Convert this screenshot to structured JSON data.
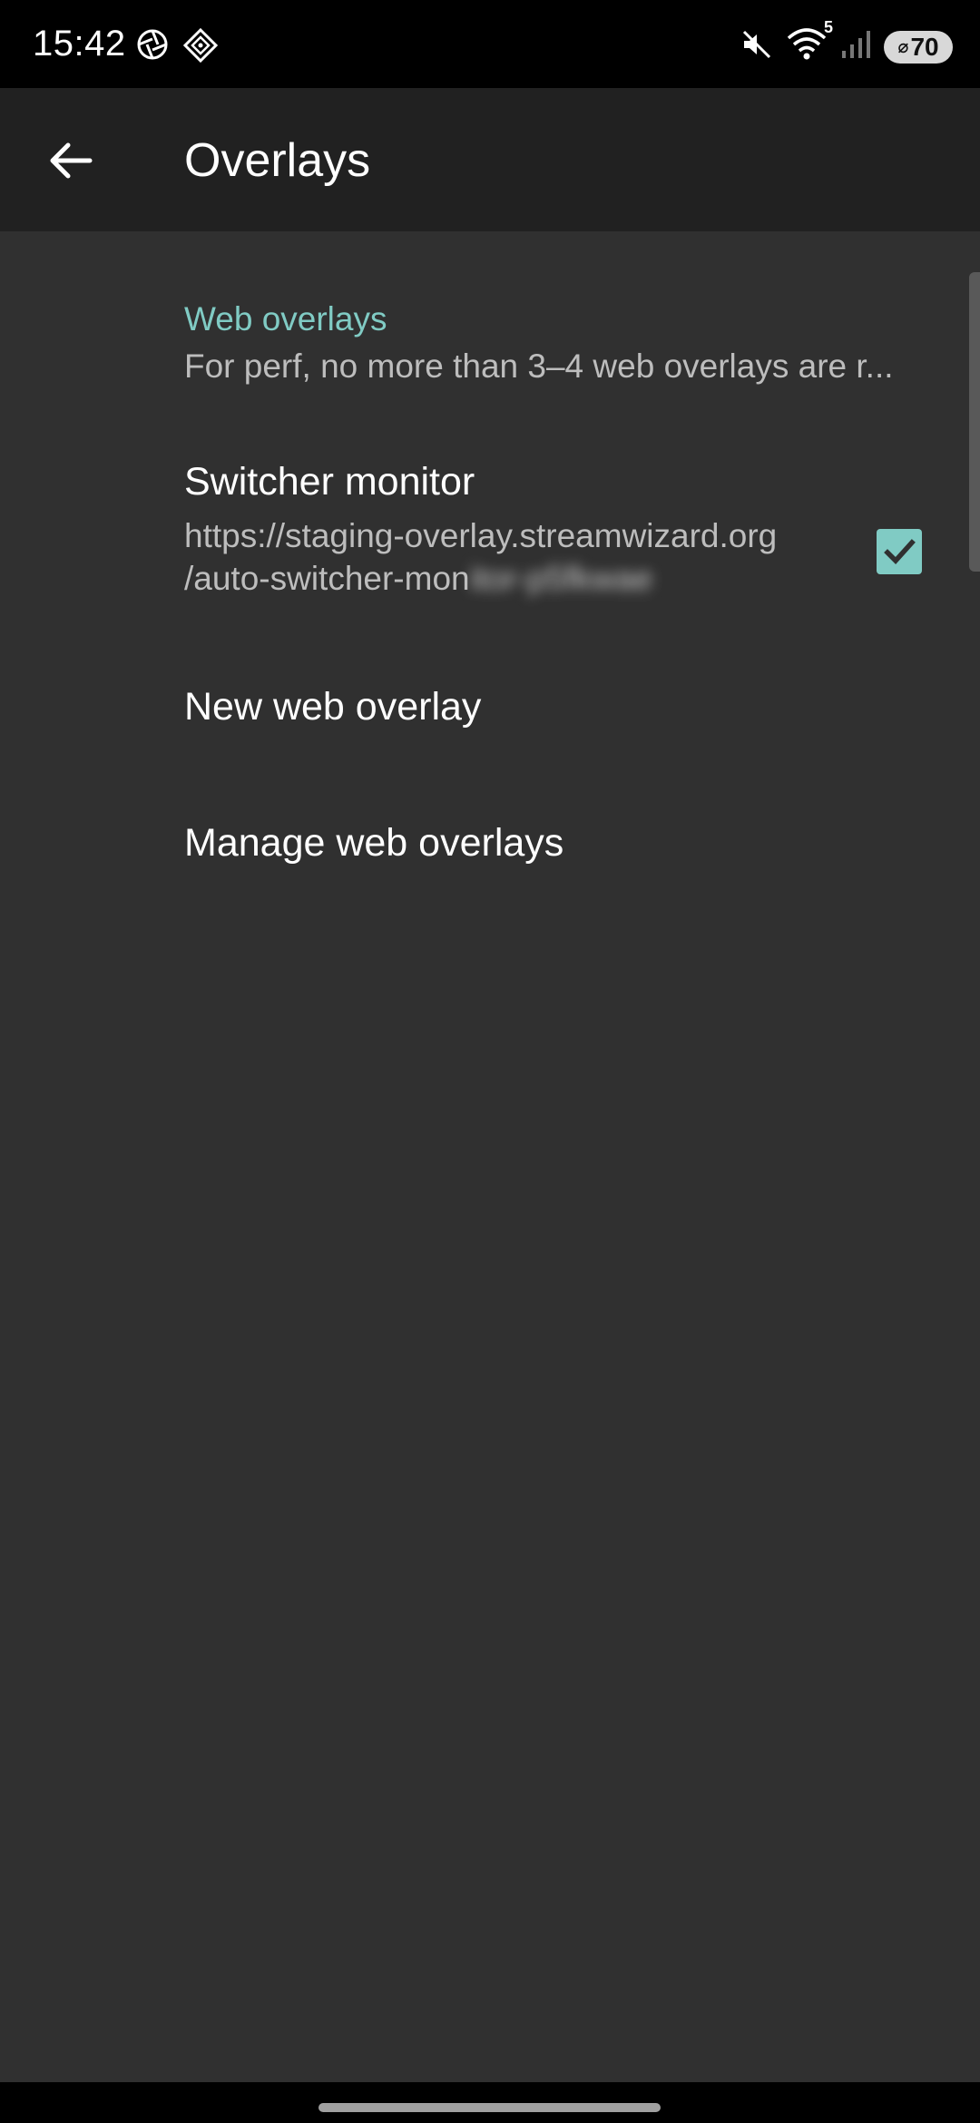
{
  "status_bar": {
    "time": "15:42",
    "left_icons": [
      "aperture-icon",
      "diamond-app-icon"
    ],
    "right_icons": [
      "mute-icon",
      "wifi-icon",
      "signal-icon"
    ],
    "wifi_badge": "5",
    "battery_level": "70"
  },
  "app_bar": {
    "title": "Overlays",
    "back_icon": "arrow-left-icon"
  },
  "section": {
    "header": "Web overlays",
    "summary": "For perf, no more than 3–4 web overlays are r..."
  },
  "items": [
    {
      "title": "Switcher monitor",
      "url_line1": "https://staging-overlay.streamwizard.org",
      "url_line2_visible": "/auto-switcher-mon",
      "url_line2_blurred": "itor-p5fkwae",
      "checked": true
    },
    {
      "title": "New web overlay"
    },
    {
      "title": "Manage web overlays"
    }
  ],
  "colors": {
    "accent": "#80cbc4",
    "background": "#303030",
    "app_bar": "#212121",
    "status_bar": "#000000"
  }
}
